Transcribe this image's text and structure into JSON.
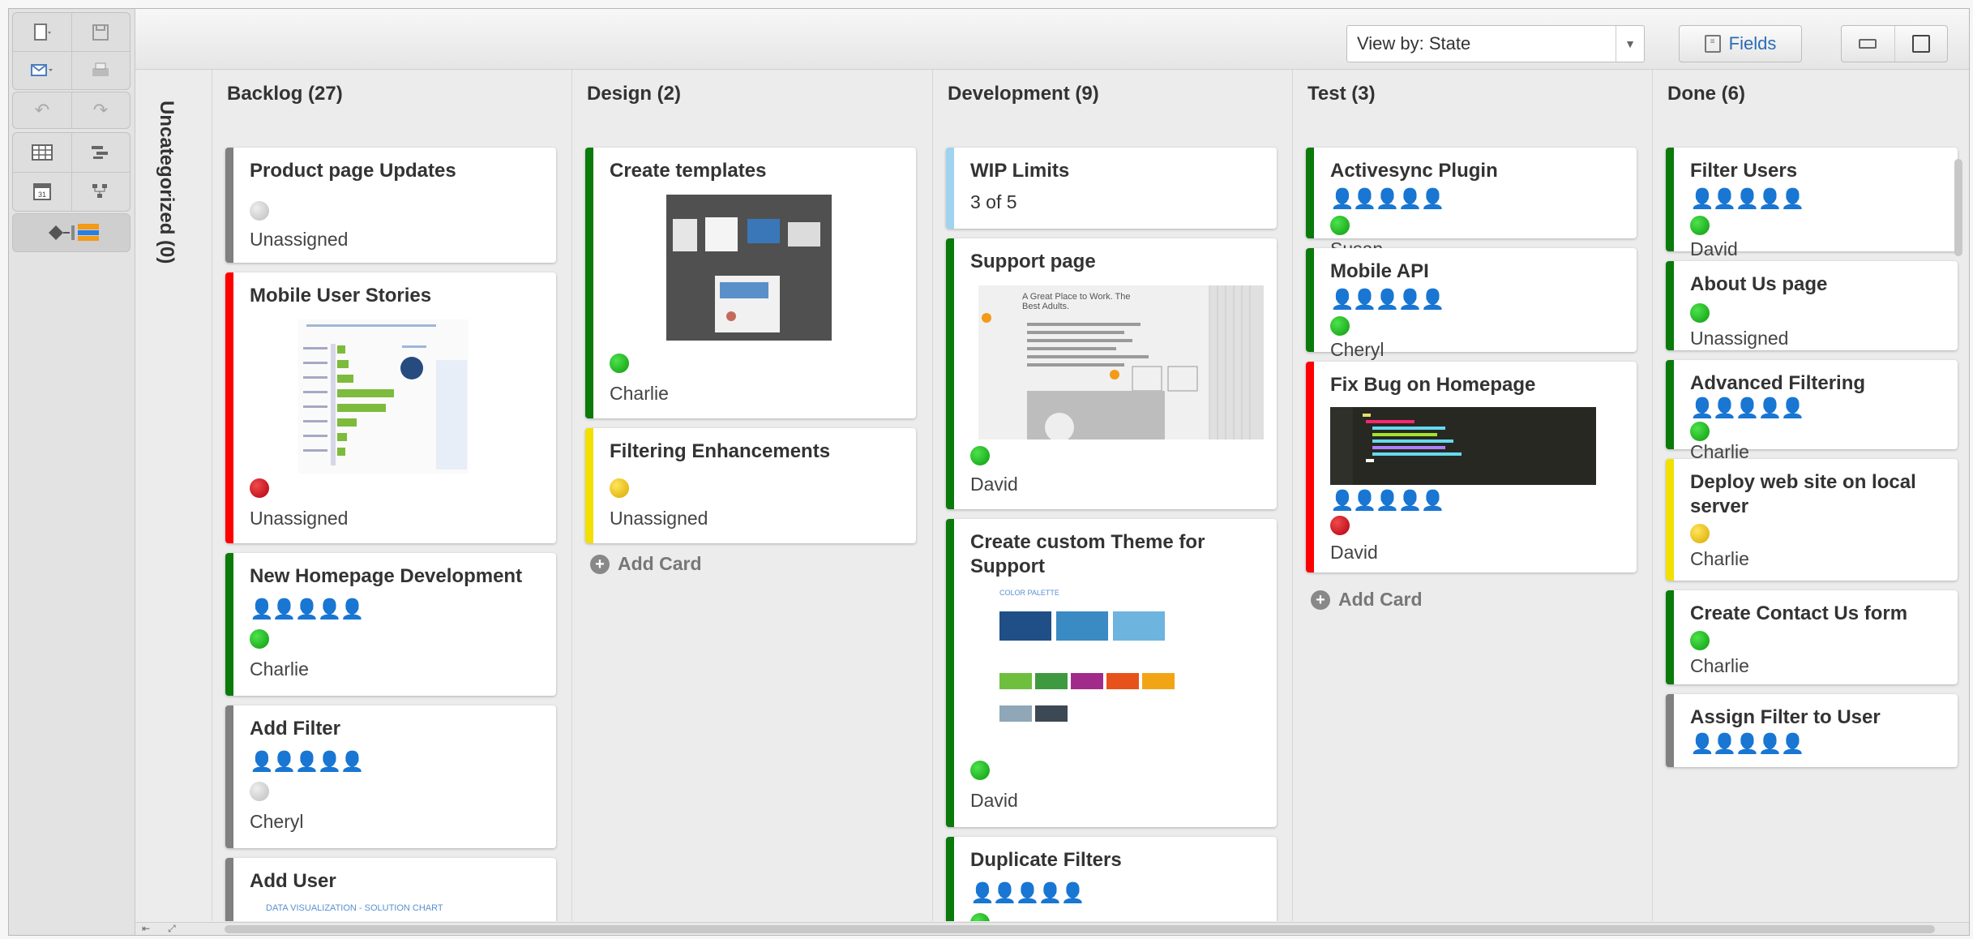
{
  "toolbar": {
    "buttons": [
      "new-document",
      "save",
      "email",
      "print",
      "undo",
      "redo",
      "grid-view",
      "gantt-view",
      "calendar-view",
      "tree-view",
      "board-view"
    ]
  },
  "topbar": {
    "view_by": "View by: State",
    "fields_label": "Fields"
  },
  "uncategorized": {
    "label": "Uncategorized (0)"
  },
  "lanes": [
    {
      "title": "Backlog (27)"
    },
    {
      "title": "Design (2)"
    },
    {
      "title": "Development (9)"
    },
    {
      "title": "Test (3)"
    },
    {
      "title": "Done (6)"
    }
  ],
  "backlog": {
    "cards": [
      {
        "title": "Product page Updates",
        "assignee": "Unassigned",
        "status": "gray",
        "bar": "#808080"
      },
      {
        "title": "Mobile User Stories",
        "assignee": "Unassigned",
        "status": "red",
        "bar": "#ff0000"
      },
      {
        "title": "New Homepage Development",
        "assignee": "Charlie",
        "status": "green",
        "bar": "#0a7a0a",
        "people": 4
      },
      {
        "title": "Add Filter",
        "assignee": "Cheryl",
        "status": "gray",
        "bar": "#808080",
        "people": 4
      },
      {
        "title": "Add User",
        "bar": "#808080",
        "thumb_text": "DATA VISUALIZATION - SOLUTION CHART"
      }
    ]
  },
  "design": {
    "cards": [
      {
        "title": "Create templates",
        "assignee": "Charlie",
        "status": "green",
        "bar": "#0a7a0a"
      },
      {
        "title": "Filtering Enhancements",
        "assignee": "Unassigned",
        "status": "yellow",
        "bar": "#f2e000"
      }
    ],
    "add_card": "Add Card"
  },
  "development": {
    "cards": [
      {
        "title": "WIP Limits",
        "sub": "3 of 5",
        "bar": "#9fd3f0"
      },
      {
        "title": "Support page",
        "assignee": "David",
        "status": "green",
        "bar": "#0a7a0a",
        "thumb_text": "A Great Place to Work. The Best Adults."
      },
      {
        "title": "Create custom Theme for Support",
        "assignee": "David",
        "status": "green",
        "bar": "#0a7a0a",
        "thumb_text": "COLOR PALETTE"
      },
      {
        "title": "Duplicate Filters",
        "status": "green",
        "bar": "#0a7a0a",
        "people": 3
      }
    ]
  },
  "test": {
    "cards": [
      {
        "title": "Activesync Plugin",
        "assignee": "Susan",
        "status": "green",
        "bar": "#0a7a0a",
        "people": 4
      },
      {
        "title": "Mobile API",
        "assignee": "Cheryl",
        "status": "green",
        "bar": "#0a7a0a",
        "people": 4
      },
      {
        "title": "Fix Bug on Homepage",
        "assignee": "David",
        "status": "red",
        "bar": "#ff0000",
        "people": 3
      }
    ],
    "add_card": "Add Card"
  },
  "done": {
    "cards": [
      {
        "title": "Filter Users",
        "assignee": "David",
        "status": "green",
        "bar": "#0a7a0a",
        "people": 3
      },
      {
        "title": "About Us page",
        "assignee": "Unassigned",
        "status": "green",
        "bar": "#0a7a0a"
      },
      {
        "title": "Advanced Filtering",
        "assignee": "Charlie",
        "status": "green",
        "bar": "#0a7a0a",
        "people": 3
      },
      {
        "title": "Deploy web site on local server",
        "assignee": "Charlie",
        "status": "yellow",
        "bar": "#f2e000"
      },
      {
        "title": "Create Contact Us form",
        "assignee": "Charlie",
        "status": "green",
        "bar": "#0a7a0a"
      },
      {
        "title": "Assign Filter to User",
        "bar": "#808080",
        "people": 2
      }
    ]
  }
}
